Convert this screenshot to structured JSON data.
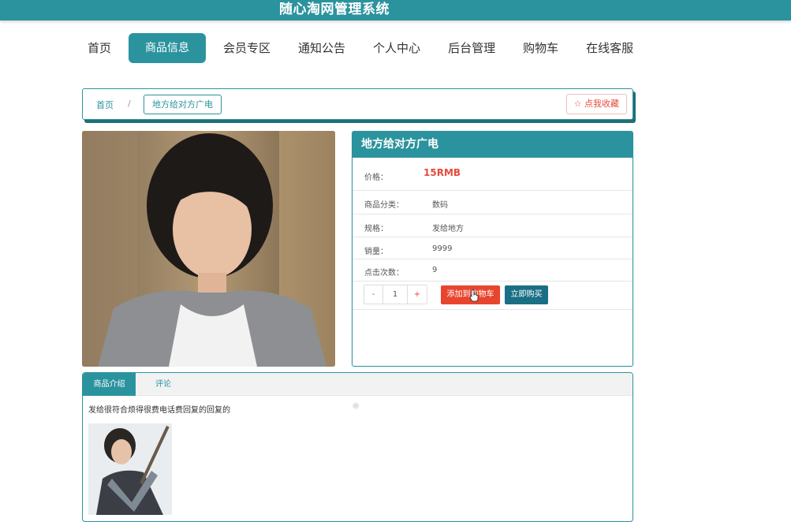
{
  "app": {
    "title": "随心淘网管理系统"
  },
  "nav": {
    "items": [
      {
        "label": "首页"
      },
      {
        "label": "商品信息"
      },
      {
        "label": "会员专区"
      },
      {
        "label": "通知公告"
      },
      {
        "label": "个人中心"
      },
      {
        "label": "后台管理"
      },
      {
        "label": "购物车"
      },
      {
        "label": "在线客服"
      }
    ],
    "active_index": 1
  },
  "breadcrumb": {
    "home": "首页",
    "separator": "/",
    "current": "地方给对方广电",
    "favorite_label": "☆ 点我收藏"
  },
  "product": {
    "name": "地方给对方广电",
    "price_label": "价格：",
    "price": "15RMB",
    "category_label": "商品分类：",
    "category": "数码",
    "spec_label": "规格：",
    "spec": "发给地方",
    "sales_label": "销量：",
    "sales": "9999",
    "clicks_label": "点击次数：",
    "clicks": "9",
    "quantity": {
      "minus": "-",
      "value": "1",
      "plus": "+"
    },
    "add_to_cart": "添加到购物车",
    "buy_now": "立即购买"
  },
  "details": {
    "tabs": [
      {
        "label": "商品介绍"
      },
      {
        "label": "评论"
      }
    ],
    "active_tab": 0,
    "description": "发给很符合烦得很费电话费回复的回复的"
  },
  "colors": {
    "primary": "#2b939e",
    "danger": "#e8452f",
    "buy": "#1a6f85"
  }
}
